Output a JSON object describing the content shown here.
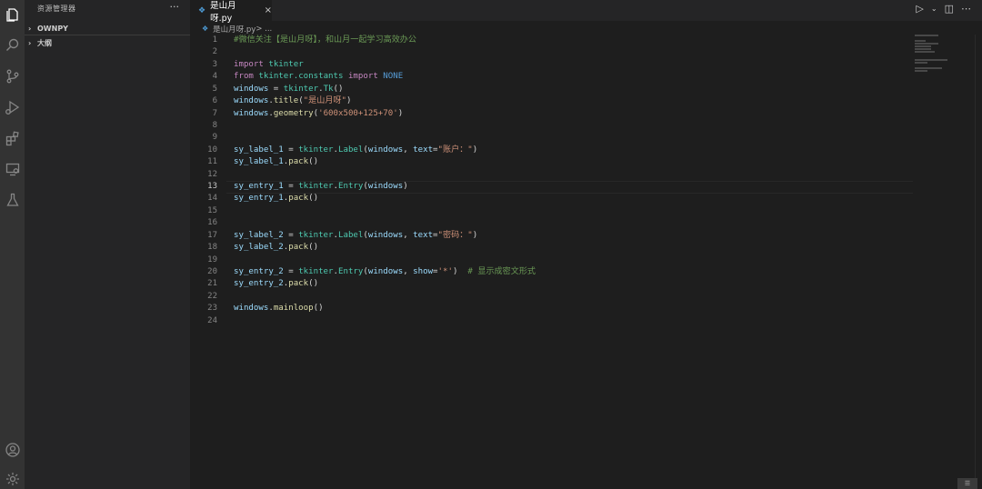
{
  "sidebar": {
    "title": "资源管理器",
    "more": "···",
    "sections": [
      {
        "label": "OWNPY"
      },
      {
        "label": "大纲"
      }
    ]
  },
  "tab": {
    "filename": "是山月呀.py",
    "close": "×"
  },
  "breadcrumb": {
    "file": "是山月呀.py",
    "sep": " > ..."
  },
  "editor": {
    "active_line": 13,
    "line_numbers": [
      "1",
      "2",
      "3",
      "4",
      "5",
      "6",
      "7",
      "8",
      "9",
      "10",
      "11",
      "12",
      "13",
      "14",
      "15",
      "16",
      "17",
      "18",
      "19",
      "20",
      "21",
      "22",
      "23",
      "24"
    ]
  },
  "colors": {
    "comment": "#6a9955",
    "keyword": "#c586c0",
    "variable": "#9cdcfe",
    "function": "#dcdcaa",
    "class": "#4ec9b0",
    "string": "#ce9178",
    "constant": "#569cd6",
    "plain": "#d4d4d4"
  },
  "code_lines": [
    [
      [
        "#微信关注【是山月呀】，和山月一起学习高效办公",
        "comment"
      ]
    ],
    [],
    [
      [
        "import",
        "keyword"
      ],
      [
        " ",
        "plain"
      ],
      [
        "tkinter",
        "class"
      ]
    ],
    [
      [
        "from",
        "keyword"
      ],
      [
        " ",
        "plain"
      ],
      [
        "tkinter.constants",
        "class"
      ],
      [
        " ",
        "plain"
      ],
      [
        "import",
        "keyword"
      ],
      [
        " ",
        "plain"
      ],
      [
        "NONE",
        "constant"
      ]
    ],
    [
      [
        "windows",
        "variable"
      ],
      [
        " = ",
        "plain"
      ],
      [
        "tkinter",
        "class"
      ],
      [
        ".",
        "plain"
      ],
      [
        "Tk",
        "class"
      ],
      [
        "()",
        "plain"
      ]
    ],
    [
      [
        "windows",
        "variable"
      ],
      [
        ".",
        "plain"
      ],
      [
        "title",
        "function"
      ],
      [
        "(",
        "plain"
      ],
      [
        "\"是山月呀\"",
        "string"
      ],
      [
        ")",
        "plain"
      ]
    ],
    [
      [
        "windows",
        "variable"
      ],
      [
        ".",
        "plain"
      ],
      [
        "geometry",
        "function"
      ],
      [
        "(",
        "plain"
      ],
      [
        "'600x500+125+70'",
        "string"
      ],
      [
        ")",
        "plain"
      ]
    ],
    [],
    [],
    [
      [
        "sy_label_1",
        "variable"
      ],
      [
        " = ",
        "plain"
      ],
      [
        "tkinter",
        "class"
      ],
      [
        ".",
        "plain"
      ],
      [
        "Label",
        "class"
      ],
      [
        "(",
        "plain"
      ],
      [
        "windows",
        "variable"
      ],
      [
        ", ",
        "plain"
      ],
      [
        "text",
        "variable"
      ],
      [
        "=",
        "plain"
      ],
      [
        "\"账户：\"",
        "string"
      ],
      [
        ")",
        "plain"
      ]
    ],
    [
      [
        "sy_label_1",
        "variable"
      ],
      [
        ".",
        "plain"
      ],
      [
        "pack",
        "function"
      ],
      [
        "()",
        "plain"
      ]
    ],
    [],
    [
      [
        "sy_entry_1",
        "variable"
      ],
      [
        " = ",
        "plain"
      ],
      [
        "tkinter",
        "class"
      ],
      [
        ".",
        "plain"
      ],
      [
        "Entry",
        "class"
      ],
      [
        "(",
        "plain"
      ],
      [
        "windows",
        "variable"
      ],
      [
        ")",
        "plain"
      ]
    ],
    [
      [
        "sy_entry_1",
        "variable"
      ],
      [
        ".",
        "plain"
      ],
      [
        "pack",
        "function"
      ],
      [
        "()",
        "plain"
      ]
    ],
    [],
    [],
    [
      [
        "sy_label_2",
        "variable"
      ],
      [
        " = ",
        "plain"
      ],
      [
        "tkinter",
        "class"
      ],
      [
        ".",
        "plain"
      ],
      [
        "Label",
        "class"
      ],
      [
        "(",
        "plain"
      ],
      [
        "windows",
        "variable"
      ],
      [
        ", ",
        "plain"
      ],
      [
        "text",
        "variable"
      ],
      [
        "=",
        "plain"
      ],
      [
        "\"密码：\"",
        "string"
      ],
      [
        ")",
        "plain"
      ]
    ],
    [
      [
        "sy_label_2",
        "variable"
      ],
      [
        ".",
        "plain"
      ],
      [
        "pack",
        "function"
      ],
      [
        "()",
        "plain"
      ]
    ],
    [],
    [
      [
        "sy_entry_2",
        "variable"
      ],
      [
        " = ",
        "plain"
      ],
      [
        "tkinter",
        "class"
      ],
      [
        ".",
        "plain"
      ],
      [
        "Entry",
        "class"
      ],
      [
        "(",
        "plain"
      ],
      [
        "windows",
        "variable"
      ],
      [
        ", ",
        "plain"
      ],
      [
        "show",
        "variable"
      ],
      [
        "=",
        "plain"
      ],
      [
        "'*'",
        "string"
      ],
      [
        ")",
        "plain"
      ],
      [
        "  ",
        "plain"
      ],
      [
        "# 显示成密文形式",
        "comment"
      ]
    ],
    [
      [
        "sy_entry_2",
        "variable"
      ],
      [
        ".",
        "plain"
      ],
      [
        "pack",
        "function"
      ],
      [
        "()",
        "plain"
      ]
    ],
    [],
    [
      [
        "windows",
        "variable"
      ],
      [
        ".",
        "plain"
      ],
      [
        "mainloop",
        "function"
      ],
      [
        "()",
        "plain"
      ]
    ],
    []
  ]
}
